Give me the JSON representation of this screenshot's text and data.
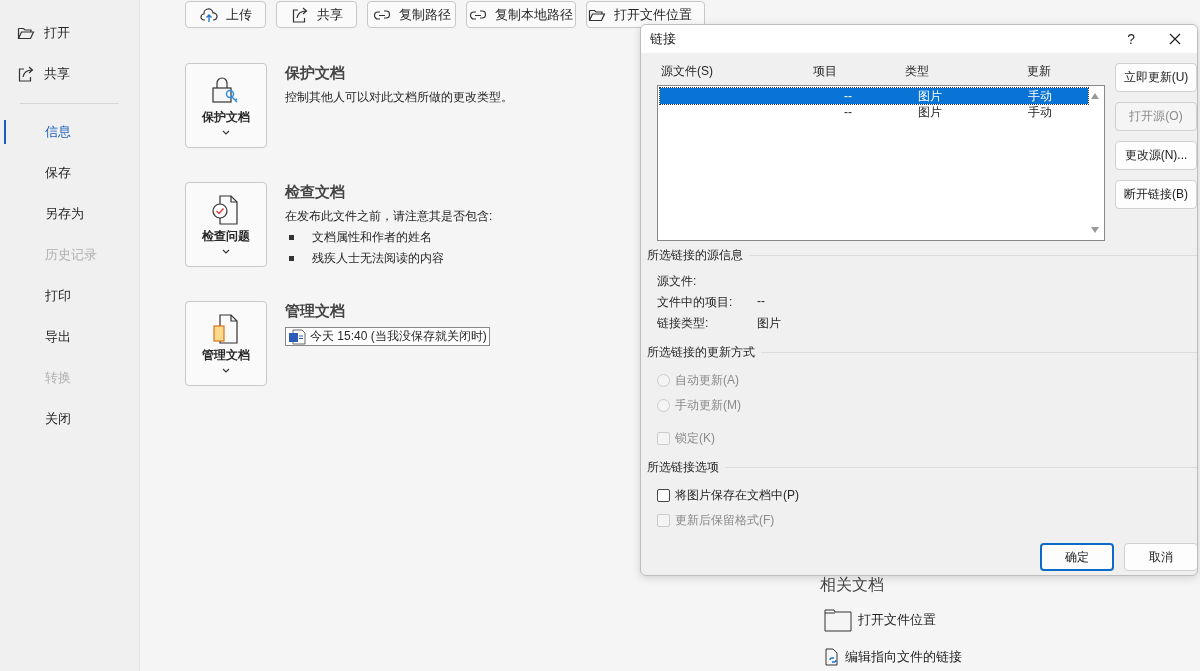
{
  "sidebar": {
    "items": [
      {
        "kind": "action",
        "label": "打开"
      },
      {
        "kind": "action",
        "label": "共享"
      },
      {
        "kind": "divider"
      },
      {
        "kind": "page",
        "label": "信息",
        "selected": true,
        "disabled": false
      },
      {
        "kind": "page",
        "label": "保存",
        "selected": false,
        "disabled": false
      },
      {
        "kind": "page",
        "label": "另存为",
        "selected": false,
        "disabled": false
      },
      {
        "kind": "page",
        "label": "历史记录",
        "selected": false,
        "disabled": true
      },
      {
        "kind": "page",
        "label": "打印",
        "selected": false,
        "disabled": false
      },
      {
        "kind": "page",
        "label": "导出",
        "selected": false,
        "disabled": false
      },
      {
        "kind": "page",
        "label": "转换",
        "selected": false,
        "disabled": true
      },
      {
        "kind": "page",
        "label": "关闭",
        "selected": false,
        "disabled": false
      }
    ]
  },
  "toolbar": {
    "buttons": [
      "上传",
      "共享",
      "复制路径",
      "复制本地路径",
      "打开文件位置"
    ]
  },
  "sections": [
    {
      "title": "保护文档",
      "button_label": "保护文档",
      "description": "控制其他人可以对此文档所做的更改类型。"
    },
    {
      "title": "检查文档",
      "button_label": "检查问题",
      "description": "在发布此文件之前，请注意其是否包含:",
      "bullets": [
        "文档属性和作者的姓名",
        "残疾人士无法阅读的内容"
      ]
    },
    {
      "title": "管理文档",
      "button_label": "管理文档",
      "version": "今天 15:40 (当我没保存就关闭时)"
    }
  ],
  "related_docs": {
    "heading": "相关文档",
    "items": [
      "打开文件位置",
      "编辑指向文件的链接"
    ]
  },
  "dialog": {
    "title": "链接",
    "help": "?",
    "columns": [
      "源文件(S)",
      "项目",
      "类型",
      "更新"
    ],
    "rows": [
      {
        "item": "--",
        "type": "图片",
        "update": "手动",
        "selected": true
      },
      {
        "item": "--",
        "type": "图片",
        "update": "手动",
        "selected": false
      }
    ],
    "side_buttons": [
      {
        "label": "立即更新(U)",
        "disabled": false
      },
      {
        "label": "打开源(O)",
        "disabled": true
      },
      {
        "label": "更改源(N)...",
        "disabled": false
      },
      {
        "label": "断开链接(B)",
        "disabled": false
      }
    ],
    "source_info": {
      "heading": "所选链接的源信息",
      "fields": [
        {
          "label": "源文件:"
        },
        {
          "label": "文件中的项目:",
          "value": "--"
        },
        {
          "label": "链接类型:",
          "value": "图片"
        }
      ]
    },
    "update_method": {
      "heading": "所选链接的更新方式",
      "options": [
        {
          "kind": "radio",
          "label": "自动更新(A)",
          "checked": false,
          "disabled": true
        },
        {
          "kind": "radio",
          "label": "手动更新(M)",
          "checked": false,
          "disabled": true
        },
        {
          "kind": "checkbox",
          "label": "锁定(K)",
          "checked": false,
          "disabled": true
        }
      ]
    },
    "link_options": {
      "heading": "所选链接选项",
      "options": [
        {
          "kind": "checkbox",
          "label": "将图片保存在文档中(P)",
          "checked": false,
          "disabled": false
        },
        {
          "kind": "checkbox",
          "label": "更新后保留格式(F)",
          "checked": false,
          "disabled": true
        }
      ]
    },
    "footer_buttons": [
      {
        "label": "确定",
        "default": true
      },
      {
        "label": "取消",
        "default": false
      }
    ]
  }
}
